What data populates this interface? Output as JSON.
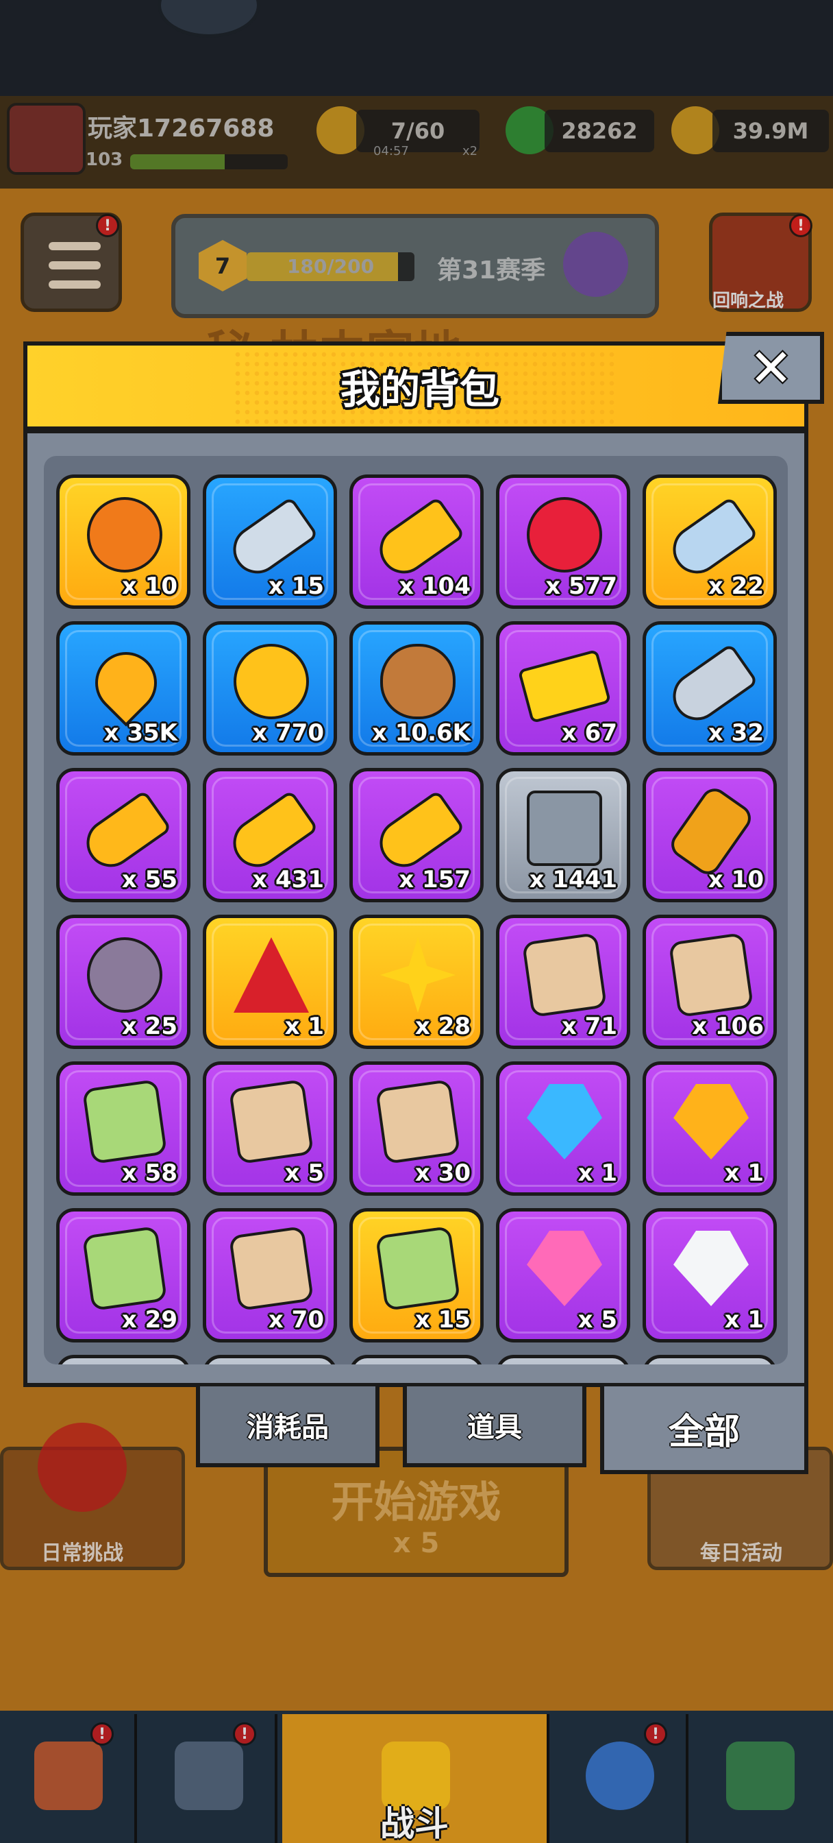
{
  "hud": {
    "player_name": "玩家17267688",
    "player_level": "103",
    "player_xp_fraction": 0.6,
    "energy": "7/60",
    "energy_timer": "04:57",
    "energy_multiplier": "x2",
    "gems": "28262",
    "gold": "39.9M"
  },
  "season": {
    "level": "7",
    "progress": "180/200",
    "progress_fraction": 0.9,
    "name": "第31赛季"
  },
  "top_buttons": {
    "echo_battle": "回响之战"
  },
  "background_title": "秘 林中富地",
  "backpack": {
    "title": "我的背包",
    "close": "✕",
    "items": [
      {
        "qty": "x 10",
        "frame": "gold",
        "icon": "orange-token-icon",
        "color": "#f07a1a"
      },
      {
        "qty": "x 15",
        "frame": "blue",
        "icon": "silver-key-icon",
        "color": "#d0dce8"
      },
      {
        "qty": "x 104",
        "frame": "purple",
        "icon": "gold-key-icon",
        "color": "#ffc21a"
      },
      {
        "qty": "x 577",
        "frame": "purple",
        "icon": "heart-medal-icon",
        "color": "#e8203a"
      },
      {
        "qty": "x 22",
        "frame": "gold",
        "icon": "crystal-key-icon",
        "color": "#b8d6f0"
      },
      {
        "qty": "x 35K",
        "frame": "blue",
        "icon": "flame-drop-icon",
        "color": "#ffb21a"
      },
      {
        "qty": "x 770",
        "frame": "blue",
        "icon": "gold-coin-icon",
        "color": "#ffc21a"
      },
      {
        "qty": "x 10.6K",
        "frame": "blue",
        "icon": "dog-cookie-icon",
        "color": "#c27a3a"
      },
      {
        "qty": "x 67",
        "frame": "purple",
        "icon": "gold-ticket-icon",
        "color": "#ffd21a"
      },
      {
        "qty": "x 32",
        "frame": "blue",
        "icon": "silver-skull-key-icon",
        "color": "#c8d2de"
      },
      {
        "qty": "x 55",
        "frame": "purple",
        "icon": "gold-face-key-icon",
        "color": "#ffb81a"
      },
      {
        "qty": "x 431",
        "frame": "purple",
        "icon": "amethyst-key-icon",
        "color": "#ffc21a"
      },
      {
        "qty": "x 157",
        "frame": "purple",
        "icon": "hex-key-icon",
        "color": "#ffc21a"
      },
      {
        "qty": "x 1441",
        "frame": "gray",
        "icon": "metal-cube-icon",
        "color": "#8a96a4"
      },
      {
        "qty": "x 10",
        "frame": "purple",
        "icon": "barrel-canister-icon",
        "color": "#f0a21a"
      },
      {
        "qty": "x 25",
        "frame": "purple",
        "icon": "ruby-orb-icon",
        "color": "#8a7a9a"
      },
      {
        "qty": "x 1",
        "frame": "gold",
        "icon": "red-triangle-icon",
        "color": "#d8202a"
      },
      {
        "qty": "x 28",
        "frame": "gold",
        "icon": "gold-star-icon",
        "color": "#ffd21a"
      },
      {
        "qty": "x 71",
        "frame": "purple",
        "icon": "puzzle-piece-icon",
        "color": "#e8c8a0"
      },
      {
        "qty": "x 106",
        "frame": "purple",
        "icon": "puzzle-piece-icon",
        "color": "#e8c8a0"
      },
      {
        "qty": "x 58",
        "frame": "purple",
        "icon": "puzzle-piece-icon",
        "color": "#a8d878"
      },
      {
        "qty": "x 5",
        "frame": "purple",
        "icon": "puzzle-piece-icon",
        "color": "#e8c8a0"
      },
      {
        "qty": "x 30",
        "frame": "purple",
        "icon": "puzzle-piece-icon",
        "color": "#e8c8a0"
      },
      {
        "qty": "x 1",
        "frame": "purple",
        "icon": "blue-gem-icon",
        "color": "#3ab8ff"
      },
      {
        "qty": "x 1",
        "frame": "purple",
        "icon": "orange-gem-icon",
        "color": "#ffb21a"
      },
      {
        "qty": "x 29",
        "frame": "purple",
        "icon": "puzzle-piece-icon",
        "color": "#a8d878"
      },
      {
        "qty": "x 70",
        "frame": "purple",
        "icon": "puzzle-piece-icon",
        "color": "#e8c8a0"
      },
      {
        "qty": "x 15",
        "frame": "gold",
        "icon": "skull-puzzle-icon",
        "color": "#a8d878"
      },
      {
        "qty": "x 5",
        "frame": "purple",
        "icon": "pink-gem-icon",
        "color": "#ff6ab8"
      },
      {
        "qty": "x 1",
        "frame": "purple",
        "icon": "white-gem-icon",
        "color": "#f4f6f8"
      }
    ],
    "tabs": [
      {
        "label": "消耗品",
        "active": false
      },
      {
        "label": "道具",
        "active": false
      },
      {
        "label": "全部",
        "active": true
      }
    ]
  },
  "lobby": {
    "daily_challenge": "日常挑战",
    "start_game": "开始游戏",
    "start_cost": "x 5",
    "daily_activity": "每日活动"
  },
  "nav": {
    "battle": "战斗"
  }
}
